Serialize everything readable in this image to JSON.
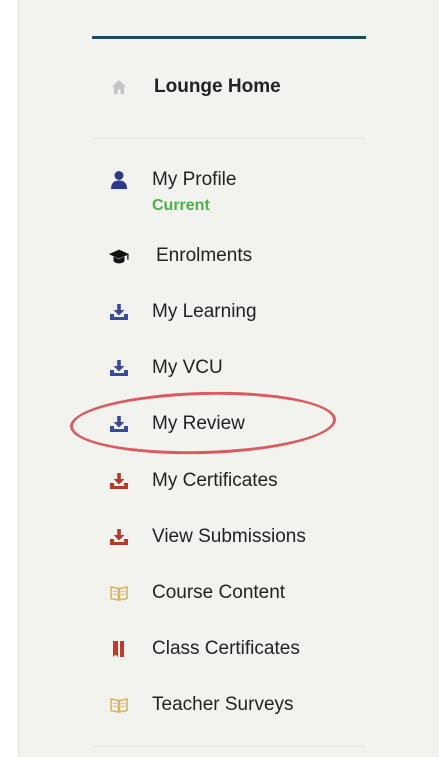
{
  "nav": {
    "home": {
      "label": "Lounge Home",
      "icon": "home-icon"
    },
    "items": [
      {
        "label": "My Profile",
        "sub": "Current",
        "icon": "user-icon",
        "color": "#2b3a8c"
      },
      {
        "label": "Enrolments",
        "icon": "graduation-cap-icon",
        "color": "#111111"
      },
      {
        "label": "My Learning",
        "icon": "download-tray-icon",
        "color": "#3a4a9a"
      },
      {
        "label": "My VCU",
        "icon": "download-tray-icon",
        "color": "#3a4a9a"
      },
      {
        "label": "My Review",
        "icon": "download-tray-icon",
        "color": "#3a4a9a"
      },
      {
        "label": "My Certificates",
        "icon": "download-tray-icon",
        "color": "#b83a2a"
      },
      {
        "label": "View Submissions",
        "icon": "download-tray-icon",
        "color": "#b83a2a"
      },
      {
        "label": "Course Content",
        "icon": "book-icon",
        "color": "#d8b46a"
      },
      {
        "label": "Class Certificates",
        "icon": "bookmark-icon",
        "color": "#c0392b"
      },
      {
        "label": "Teacher Surveys",
        "icon": "book-icon",
        "color": "#d8b46a"
      }
    ],
    "highlight_color": "#d95b5f",
    "sub_color": "#4cb04c"
  }
}
